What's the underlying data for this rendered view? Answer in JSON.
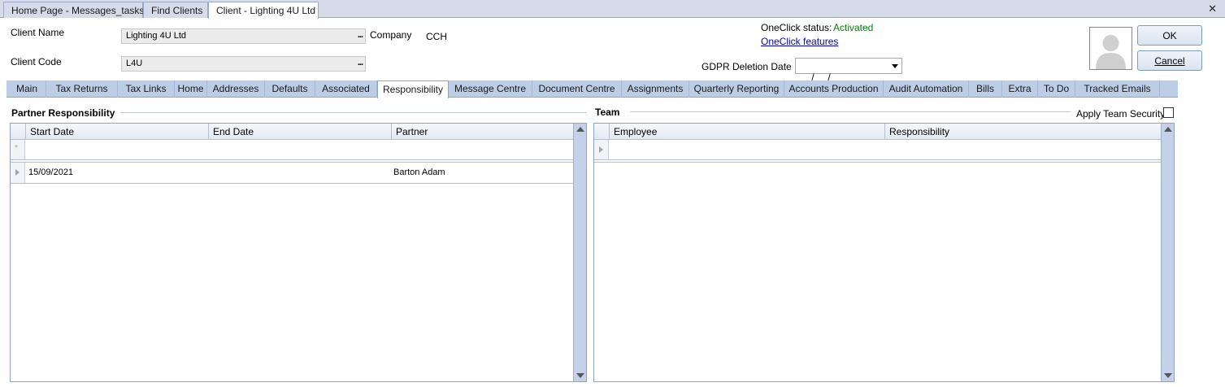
{
  "doc_tabs": [
    {
      "label": "Home Page - Messages_tasks"
    },
    {
      "label": "Find Clients"
    },
    {
      "label": "Client - Lighting 4U Ltd"
    }
  ],
  "header": {
    "client_name_label": "Client Name",
    "client_name_value": "Lighting 4U Ltd",
    "client_code_label": "Client Code",
    "client_code_value": "L4U",
    "company_label": "Company",
    "company_value": "CCH",
    "oneclick_status_label": "OneClick status:",
    "oneclick_status_value": "Activated",
    "oneclick_features_link": "OneClick features",
    "gdpr_label": "GDPR Deletion Date",
    "gdpr_value": "  /     /",
    "ok_label": "OK",
    "cancel_label": "Cancel",
    "ellipsis": "..."
  },
  "main_tabs": [
    {
      "label": "Main"
    },
    {
      "label": "Tax Returns"
    },
    {
      "label": "Tax Links"
    },
    {
      "label": "Home"
    },
    {
      "label": "Addresses"
    },
    {
      "label": "Defaults"
    },
    {
      "label": "Associated"
    },
    {
      "label": "Responsibility",
      "active": true
    },
    {
      "label": "Message Centre"
    },
    {
      "label": "Document Centre"
    },
    {
      "label": "Assignments"
    },
    {
      "label": "Quarterly Reporting"
    },
    {
      "label": "Accounts Production"
    },
    {
      "label": "Audit Automation"
    },
    {
      "label": "Bills"
    },
    {
      "label": "Extra"
    },
    {
      "label": "To Do"
    },
    {
      "label": "Tracked Emails"
    }
  ],
  "partner_responsibility": {
    "title": "Partner Responsibility",
    "columns": [
      "Start Date",
      "End Date",
      "Partner"
    ],
    "new_row_marker": "*",
    "rows": [
      {
        "start_date": "15/09/2021",
        "end_date": "",
        "partner": "Barton Adam"
      }
    ]
  },
  "team": {
    "title": "Team",
    "apply_security_label": "Apply Team Security",
    "apply_security_checked": false,
    "columns": [
      "Employee",
      "Responsibility"
    ],
    "rows": []
  },
  "window": {
    "close_glyph": "✕"
  },
  "colors": {
    "status_green": "#0a7d0a",
    "link_blue": "#0000cc",
    "tab_bar": "#bccde6"
  }
}
